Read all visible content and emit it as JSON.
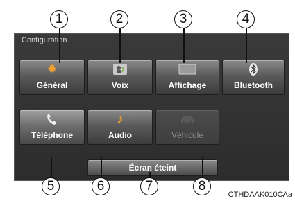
{
  "screen": {
    "title": "Configuration",
    "buttons": [
      {
        "label": "Général",
        "icon": "gear-icon",
        "state": "normal"
      },
      {
        "label": "Voix",
        "icon": "voice-icon",
        "state": "normal"
      },
      {
        "label": "Affichage",
        "icon": "display-icon",
        "state": "normal"
      },
      {
        "label": "Bluetooth",
        "icon": "bluetooth-icon",
        "state": "normal"
      },
      {
        "label": "Téléphone",
        "icon": "phone-icon",
        "state": "normal"
      },
      {
        "label": "Audio",
        "icon": "music-note-icon",
        "state": "normal"
      },
      {
        "label": "Véhicule",
        "icon": "car-icon",
        "state": "disabled"
      }
    ],
    "screen_off_label": "Écran éteint"
  },
  "callouts": [
    "1",
    "2",
    "3",
    "4",
    "5",
    "6",
    "7",
    "8"
  ],
  "figure_code": "CTHDAAK010CAa",
  "colors": {
    "icon_orange": "#f0a030",
    "icon_green": "#7fb64a",
    "screen_bg": "#333333"
  }
}
